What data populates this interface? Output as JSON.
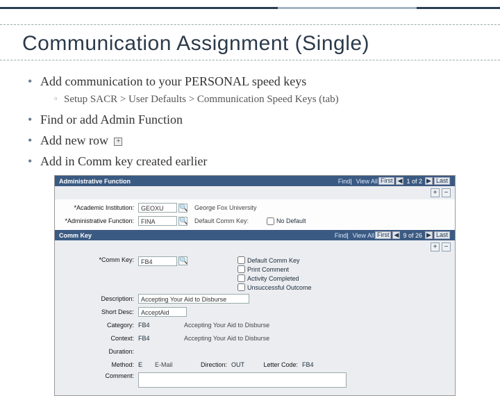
{
  "title": "Communication Assignment (Single)",
  "bullets": {
    "b1": "Add communication to your PERSONAL speed keys",
    "b1_sub": "Setup SACR > User Defaults > Communication Speed Keys (tab)",
    "b2": "Find or add Admin Function",
    "b3": "Add new row",
    "b4": "Add in Comm key created earlier",
    "plus_glyph": "+"
  },
  "app": {
    "header1": {
      "title": "Administrative Function",
      "find": "Find",
      "view_all": "View All",
      "first": "First",
      "pager": "1 of 2",
      "last": "Last",
      "prev_glyph": "◀",
      "next_glyph": "▶"
    },
    "pm": {
      "plus": "+",
      "minus": "−"
    },
    "inst": {
      "label": "Academic Institution:",
      "value": "GEOXU",
      "desc": "George Fox University",
      "lookup_glyph": "🔍"
    },
    "func": {
      "label": "Administrative Function:",
      "value": "FINA",
      "ck_label": "Default Comm Key:",
      "ck_nodefault": "No Default"
    },
    "header2": {
      "title": "Comm Key",
      "find": "Find",
      "view_all": "View All",
      "first": "First",
      "pager": "9 of 26",
      "last": "Last",
      "prev_glyph": "◀",
      "next_glyph": "▶"
    },
    "commkey": {
      "label": "Comm Key:",
      "value": "FB4",
      "ck_default": "Default Comm Key",
      "ck_print": "Print Comment",
      "ck_activity": "Activity Completed",
      "ck_unsuccessful": "Unsuccessful Outcome"
    },
    "descr": {
      "label": "Description:",
      "value": "Accepting Your Aid to Disburse"
    },
    "short": {
      "label": "Short Desc:",
      "value": "AcceptAid"
    },
    "cat": {
      "label": "Category:",
      "value": "FB4",
      "desc": "Accepting Your Aid to Disburse"
    },
    "ctx": {
      "label": "Context:",
      "value": "FB4",
      "desc": "Accepting Your Aid to Disburse"
    },
    "dur": {
      "label": "Duration:",
      "value": ""
    },
    "method": {
      "label": "Method:",
      "value": "E",
      "desc": "E-Mail",
      "dir_label": "Direction:",
      "dir_value": "OUT",
      "lc_label": "Letter Code:",
      "lc_value": "FB4"
    },
    "comment": {
      "label": "Comment:"
    }
  }
}
